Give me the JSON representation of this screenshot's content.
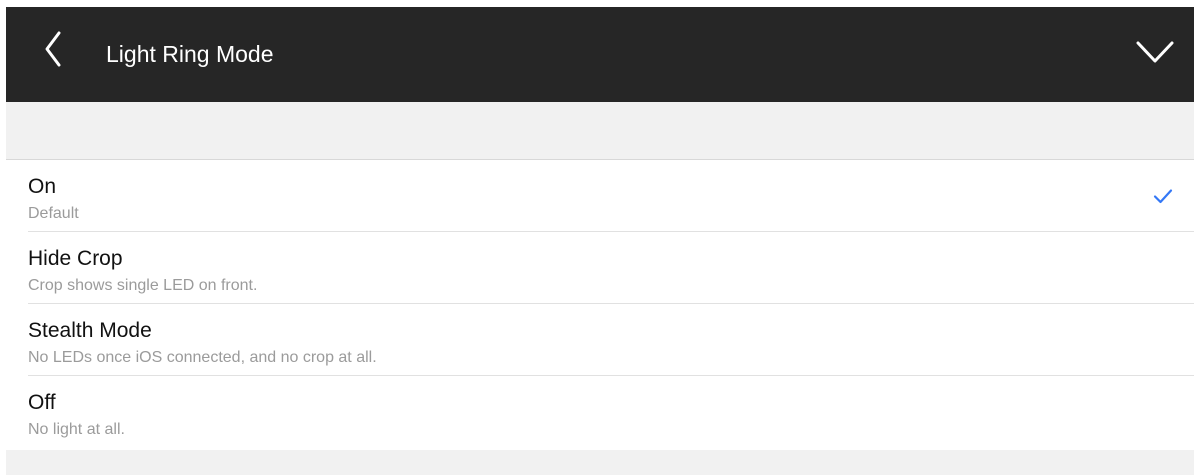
{
  "header": {
    "title": "Light Ring Mode",
    "back_icon": "chevron-left-icon",
    "dismiss_icon": "chevron-down-icon"
  },
  "options": [
    {
      "title": "On",
      "subtitle": "Default",
      "selected": true
    },
    {
      "title": "Hide Crop",
      "subtitle": "Crop shows single LED on front.",
      "selected": false
    },
    {
      "title": "Stealth Mode",
      "subtitle": "No LEDs once iOS connected, and no crop at all.",
      "selected": false
    },
    {
      "title": "Off",
      "subtitle": "No light at all.",
      "selected": false
    }
  ],
  "colors": {
    "nav_background": "#262626",
    "accent": "#3478f6",
    "group_background": "#f1f1f1"
  }
}
